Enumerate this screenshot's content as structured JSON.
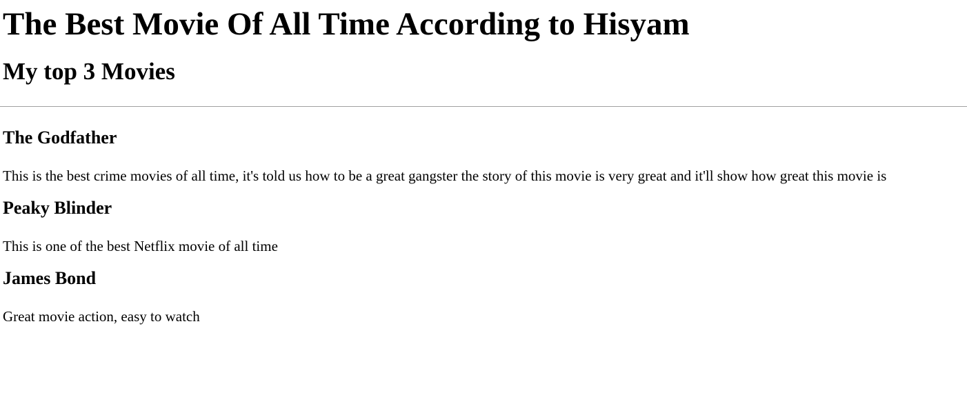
{
  "page": {
    "title": "The Best Movie Of All Time According to Hisyam",
    "subtitle": "My top 3 Movies"
  },
  "movies": [
    {
      "title": "The Godfather",
      "description": "This is the best crime movies of all time, it's told us how to be a great gangster the story of this movie is very great and it'll show how great this movie is"
    },
    {
      "title": "Peaky Blinder",
      "description": "This is one of the best Netflix movie of all time"
    },
    {
      "title": "James Bond",
      "description": "Great movie action, easy to watch"
    }
  ]
}
